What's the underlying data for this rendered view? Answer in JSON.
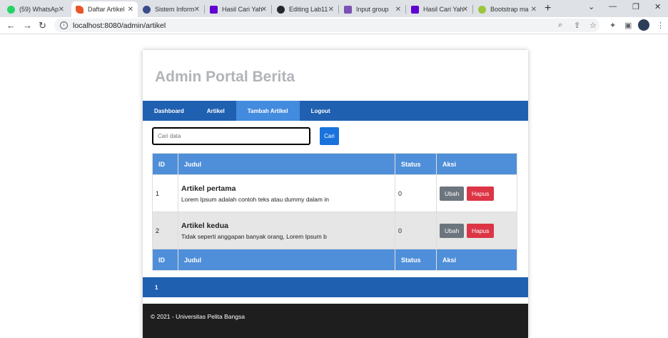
{
  "browser": {
    "tabs": [
      {
        "title": "(59) WhatsAp",
        "icon": "whatsapp-icon",
        "color": "#25d366"
      },
      {
        "title": "Daftar Artikel",
        "icon": "flame-icon",
        "color": "#e8552a"
      },
      {
        "title": "Sistem Inform",
        "icon": "university-icon",
        "color": "#3b4a8a"
      },
      {
        "title": "Hasil Cari Yah",
        "icon": "yahoo-icon",
        "color": "#6001d2"
      },
      {
        "title": "Editing Lab11",
        "icon": "github-icon",
        "color": "#24292e"
      },
      {
        "title": "Input group",
        "icon": "bootstrap-icon",
        "color": "#7952b3"
      },
      {
        "title": "Hasil Cari Yah",
        "icon": "yahoo-icon",
        "color": "#6001d2"
      },
      {
        "title": "Bootstrap ma",
        "icon": "bootstrap-icon",
        "color": "#9bc53d"
      }
    ],
    "url": "localhost:8080/admin/artikel"
  },
  "header": {
    "title": "Admin Portal Berita"
  },
  "menu": {
    "items": [
      "Dashboard",
      "Artikel",
      "Tambah Artikel",
      "Logout"
    ]
  },
  "search": {
    "placeholder": "Cari data",
    "button": "Cari"
  },
  "table": {
    "headers": [
      "ID",
      "Judul",
      "Status",
      "Aksi"
    ],
    "rows": [
      {
        "id": "1",
        "title": "Artikel pertama",
        "desc": "Lorem Ipsum adalah contoh teks atau dummy dalam in",
        "status": "0",
        "edit": "Ubah",
        "delete": "Hapus"
      },
      {
        "id": "2",
        "title": "Artikel kedua",
        "desc": "Tidak seperti anggapan banyak orang, Lorem Ipsum b",
        "status": "0",
        "edit": "Ubah",
        "delete": "Hapus"
      }
    ]
  },
  "pager": {
    "page": "1"
  },
  "footer": {
    "text": "© 2021 - Universitas Pelita Bangsa"
  }
}
